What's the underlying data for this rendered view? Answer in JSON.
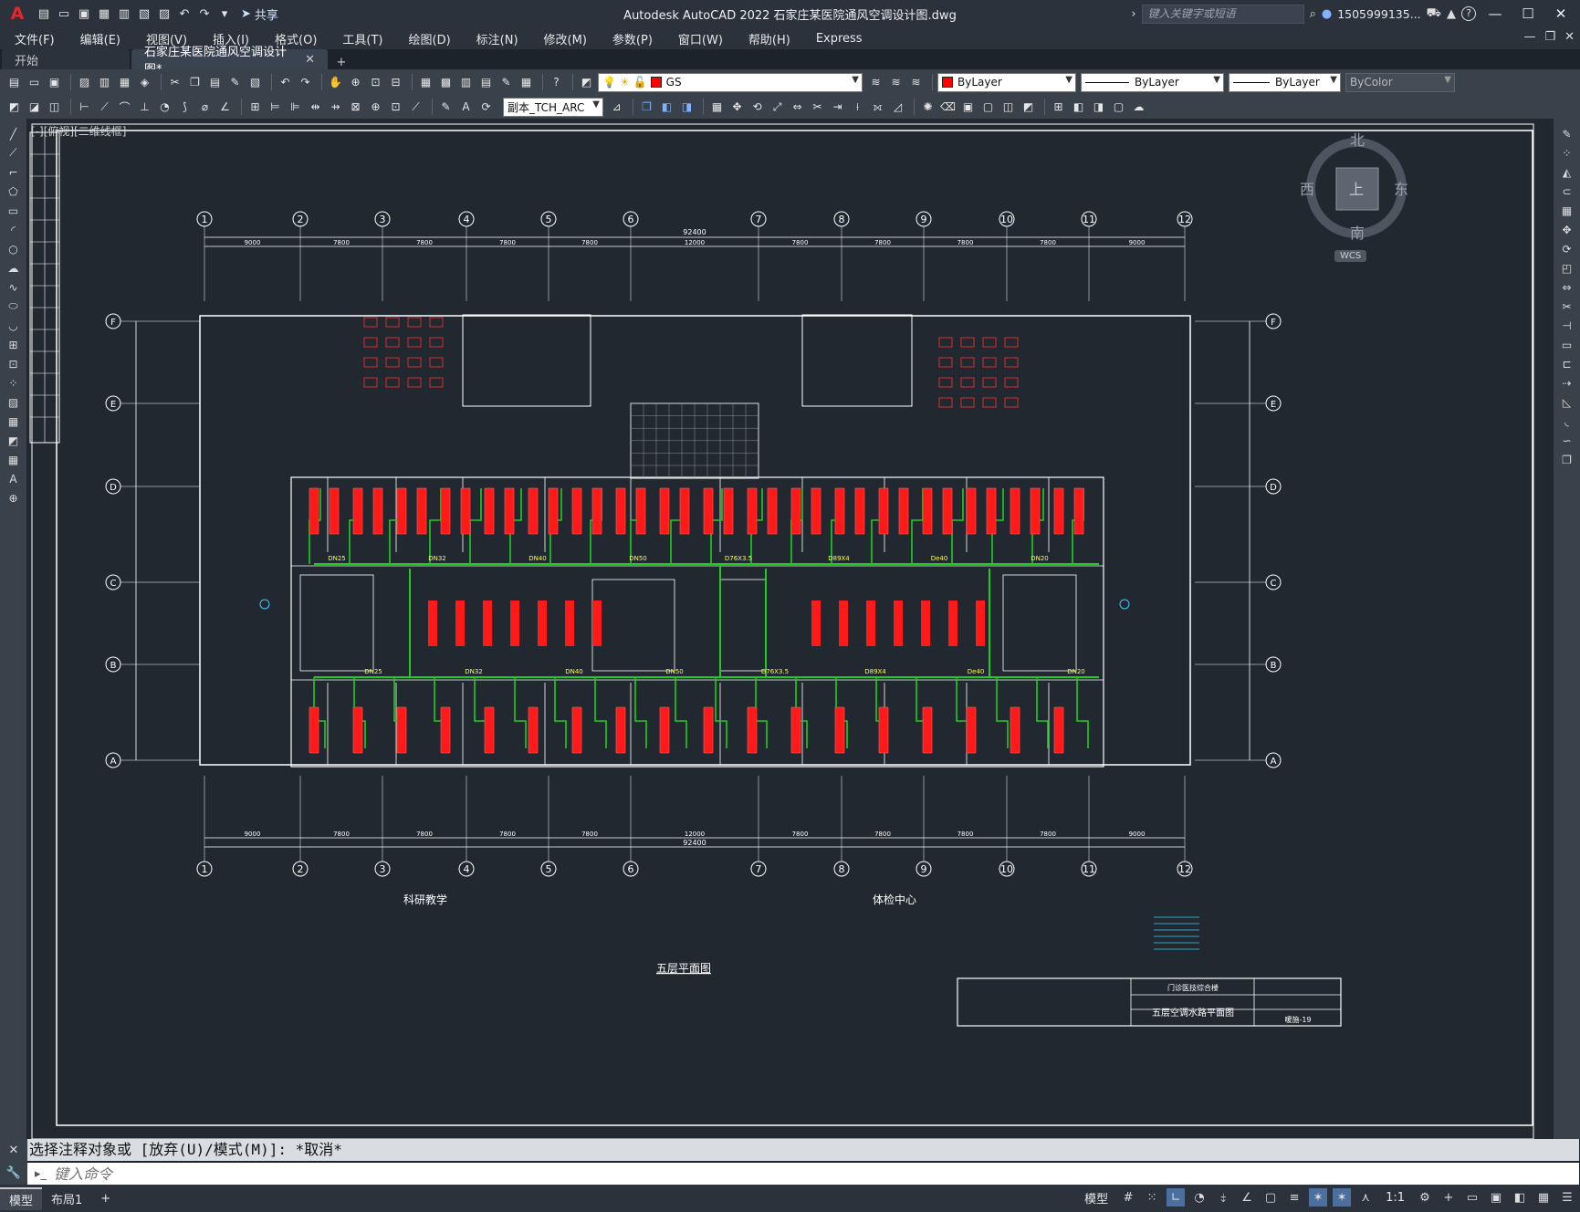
{
  "app": {
    "logo_letter": "A",
    "title": "Autodesk AutoCAD 2022    石家庄某医院通风空调设计图.dwg",
    "share": "共享",
    "search_placeholder": "键入关键字或短语",
    "user": "1505999135...",
    "help": "?"
  },
  "menus": [
    "文件(F)",
    "编辑(E)",
    "视图(V)",
    "插入(I)",
    "格式(O)",
    "工具(T)",
    "绘图(D)",
    "标注(N)",
    "修改(M)",
    "参数(P)",
    "窗口(W)",
    "帮助(H)",
    "Express"
  ],
  "tabs": [
    {
      "label": "开始"
    },
    {
      "label": "石家庄某医院通风空调设计图*"
    }
  ],
  "toolbar": {
    "layer": "GS",
    "color": "ByLayer",
    "linetype": "ByLayer",
    "lineweight": "ByLayer",
    "plotstyle": "ByColor",
    "dimstyle": "副本_TCH_ARC"
  },
  "viewport": {
    "label": "[-][俯视][二维线框]",
    "compass": {
      "north": "北",
      "south": "南",
      "east": "东",
      "west": "西",
      "center": "上",
      "wcs": "WCS"
    }
  },
  "drawing": {
    "grid_cols": [
      "1",
      "2",
      "3",
      "4",
      "5",
      "6",
      "7",
      "8",
      "9",
      "10",
      "11",
      "12"
    ],
    "grid_rows": [
      "F",
      "E",
      "D",
      "C",
      "B",
      "A"
    ],
    "total_dim": "92400",
    "top_dims": [
      "9000",
      "7800",
      "7800",
      "7800",
      "7800",
      "12000",
      "7800",
      "7800",
      "7800",
      "7800",
      "9000"
    ],
    "label_left": "科研教学",
    "label_right": "体检中心",
    "plan_title": "五层平面图",
    "titleblock": {
      "project": "门诊医技综合楼",
      "drawing": "五层空调水路平面图",
      "no": "暖施-19"
    },
    "pipe_labels": [
      "DN25",
      "DN32",
      "DN40",
      "DN50",
      "D76X3.5",
      "D89X4",
      "De40",
      "DN20"
    ]
  },
  "command": {
    "history": "选择注释对象或 [放弃(U)/模式(M)]: *取消*",
    "placeholder": "键入命令"
  },
  "status": {
    "tabs": [
      "模型",
      "布局1"
    ],
    "mode": "模型",
    "scale": "1:1"
  }
}
